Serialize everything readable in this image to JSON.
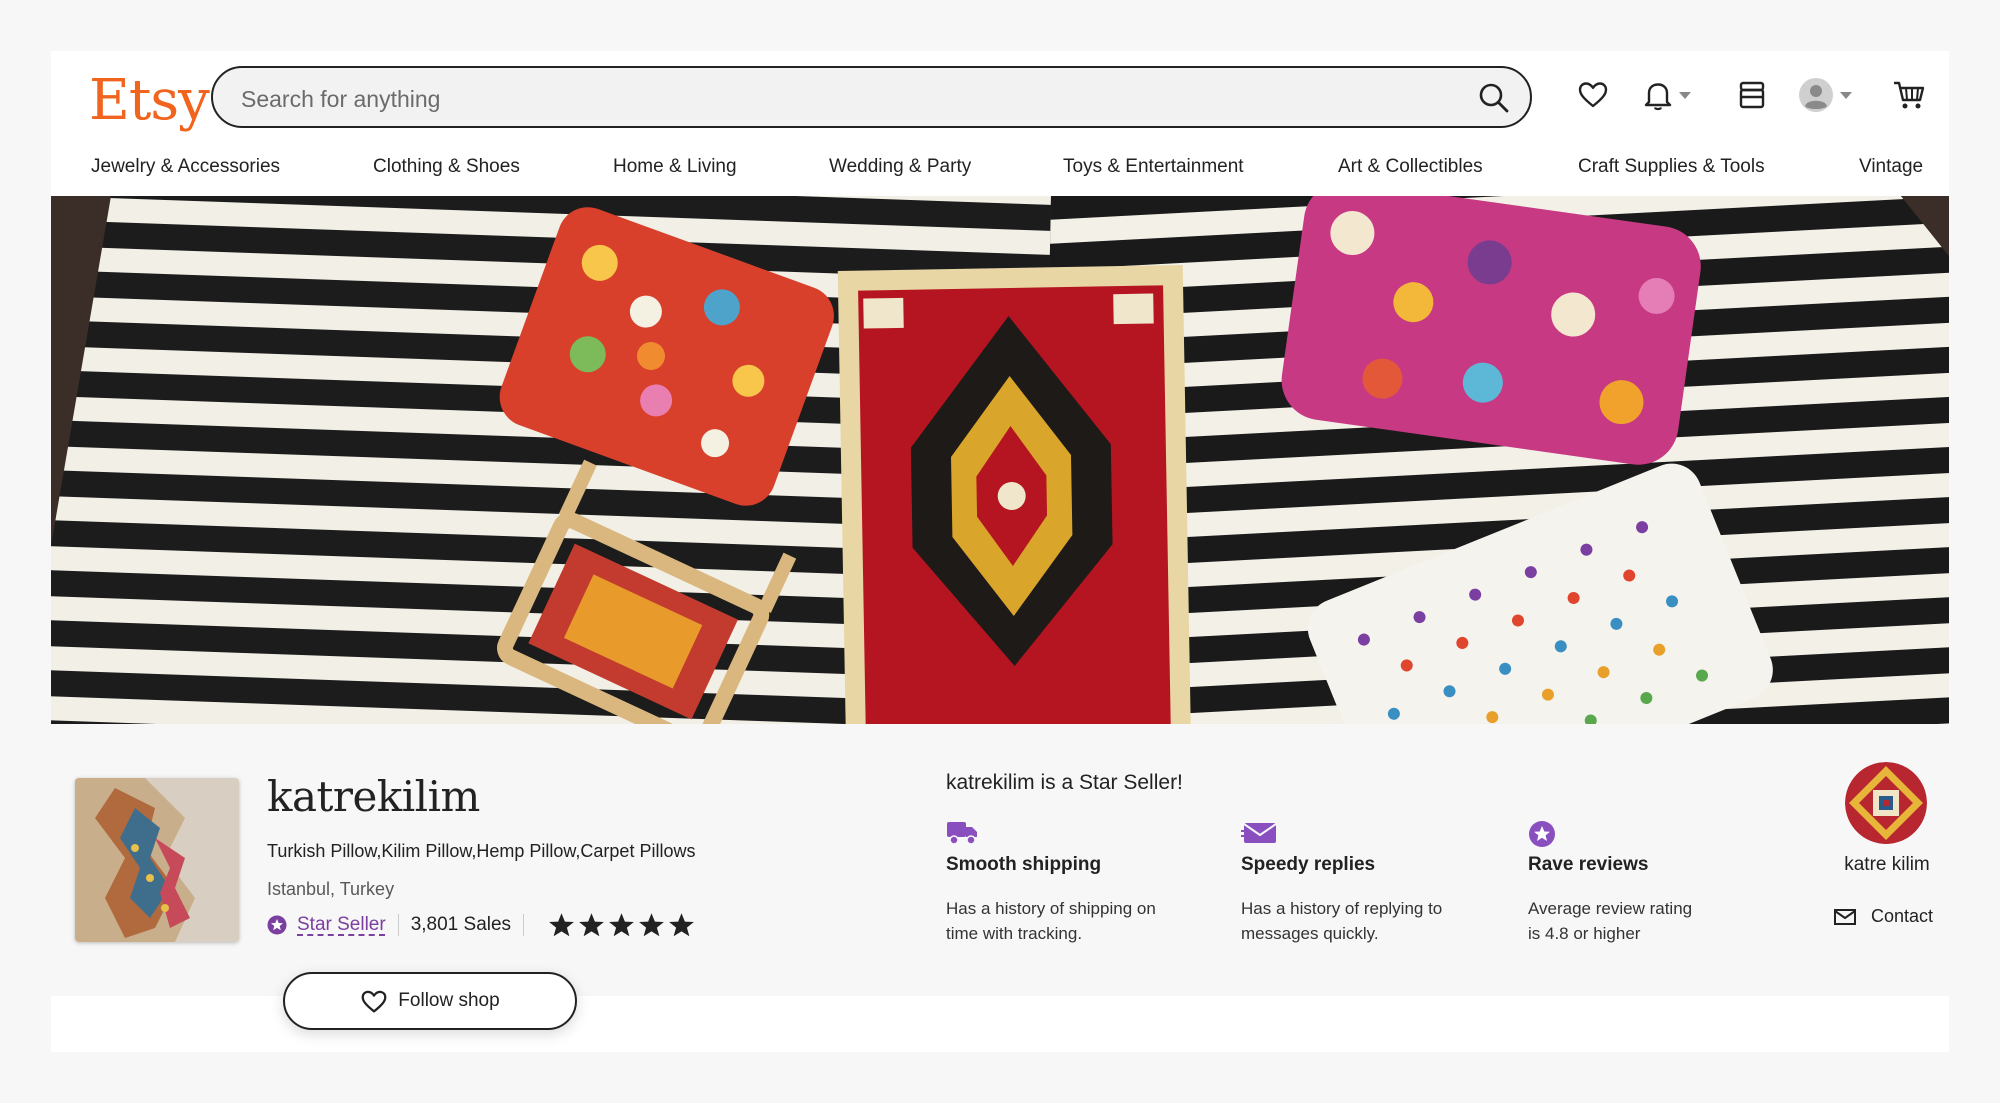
{
  "header": {
    "logo": "Etsy",
    "search_placeholder": "Search for anything"
  },
  "nav": {
    "items": [
      {
        "label": "Jewelry & Accessories"
      },
      {
        "label": "Clothing & Shoes"
      },
      {
        "label": "Home & Living"
      },
      {
        "label": "Wedding & Party"
      },
      {
        "label": "Toys & Entertainment"
      },
      {
        "label": "Art & Collectibles"
      },
      {
        "label": "Craft Supplies & Tools"
      },
      {
        "label": "Vintage"
      }
    ]
  },
  "shop": {
    "name": "katrekilim",
    "tagline": "Turkish Pillow,Kilim Pillow,Hemp Pillow,Carpet Pillows",
    "location": "Istanbul, Turkey",
    "star_seller_label": "Star Seller",
    "sales": "3,801 Sales",
    "rating_stars": 5,
    "follow_label": "Follow shop"
  },
  "star_seller": {
    "title": "katrekilim is a Star Seller!",
    "features": [
      {
        "icon": "truck-icon",
        "title": "Smooth shipping",
        "desc_line1": "Has a history of shipping on",
        "desc_line2": "time with tracking."
      },
      {
        "icon": "mail-icon",
        "title": "Speedy replies",
        "desc_line1": "Has a history of replying to",
        "desc_line2": "messages quickly."
      },
      {
        "icon": "star-badge-icon",
        "title": "Rave reviews",
        "desc_line1": "Average review rating",
        "desc_line2": "is 4.8 or higher"
      }
    ]
  },
  "owner": {
    "name": "katre kilim",
    "contact_label": "Contact"
  },
  "colors": {
    "brand": "#f1641e",
    "star_seller": "#7b3fa0"
  }
}
